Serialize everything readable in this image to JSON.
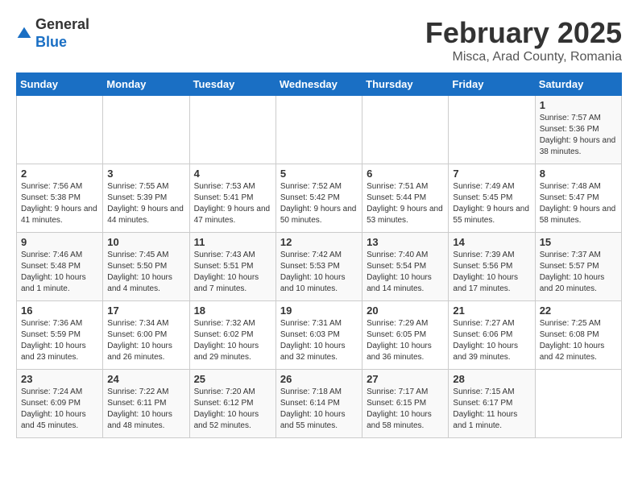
{
  "logo": {
    "general": "General",
    "blue": "Blue"
  },
  "title": "February 2025",
  "subtitle": "Misca, Arad County, Romania",
  "days_of_week": [
    "Sunday",
    "Monday",
    "Tuesday",
    "Wednesday",
    "Thursday",
    "Friday",
    "Saturday"
  ],
  "weeks": [
    [
      {
        "day": "",
        "info": ""
      },
      {
        "day": "",
        "info": ""
      },
      {
        "day": "",
        "info": ""
      },
      {
        "day": "",
        "info": ""
      },
      {
        "day": "",
        "info": ""
      },
      {
        "day": "",
        "info": ""
      },
      {
        "day": "1",
        "info": "Sunrise: 7:57 AM\nSunset: 5:36 PM\nDaylight: 9 hours and 38 minutes."
      }
    ],
    [
      {
        "day": "2",
        "info": "Sunrise: 7:56 AM\nSunset: 5:38 PM\nDaylight: 9 hours and 41 minutes."
      },
      {
        "day": "3",
        "info": "Sunrise: 7:55 AM\nSunset: 5:39 PM\nDaylight: 9 hours and 44 minutes."
      },
      {
        "day": "4",
        "info": "Sunrise: 7:53 AM\nSunset: 5:41 PM\nDaylight: 9 hours and 47 minutes."
      },
      {
        "day": "5",
        "info": "Sunrise: 7:52 AM\nSunset: 5:42 PM\nDaylight: 9 hours and 50 minutes."
      },
      {
        "day": "6",
        "info": "Sunrise: 7:51 AM\nSunset: 5:44 PM\nDaylight: 9 hours and 53 minutes."
      },
      {
        "day": "7",
        "info": "Sunrise: 7:49 AM\nSunset: 5:45 PM\nDaylight: 9 hours and 55 minutes."
      },
      {
        "day": "8",
        "info": "Sunrise: 7:48 AM\nSunset: 5:47 PM\nDaylight: 9 hours and 58 minutes."
      }
    ],
    [
      {
        "day": "9",
        "info": "Sunrise: 7:46 AM\nSunset: 5:48 PM\nDaylight: 10 hours and 1 minute."
      },
      {
        "day": "10",
        "info": "Sunrise: 7:45 AM\nSunset: 5:50 PM\nDaylight: 10 hours and 4 minutes."
      },
      {
        "day": "11",
        "info": "Sunrise: 7:43 AM\nSunset: 5:51 PM\nDaylight: 10 hours and 7 minutes."
      },
      {
        "day": "12",
        "info": "Sunrise: 7:42 AM\nSunset: 5:53 PM\nDaylight: 10 hours and 10 minutes."
      },
      {
        "day": "13",
        "info": "Sunrise: 7:40 AM\nSunset: 5:54 PM\nDaylight: 10 hours and 14 minutes."
      },
      {
        "day": "14",
        "info": "Sunrise: 7:39 AM\nSunset: 5:56 PM\nDaylight: 10 hours and 17 minutes."
      },
      {
        "day": "15",
        "info": "Sunrise: 7:37 AM\nSunset: 5:57 PM\nDaylight: 10 hours and 20 minutes."
      }
    ],
    [
      {
        "day": "16",
        "info": "Sunrise: 7:36 AM\nSunset: 5:59 PM\nDaylight: 10 hours and 23 minutes."
      },
      {
        "day": "17",
        "info": "Sunrise: 7:34 AM\nSunset: 6:00 PM\nDaylight: 10 hours and 26 minutes."
      },
      {
        "day": "18",
        "info": "Sunrise: 7:32 AM\nSunset: 6:02 PM\nDaylight: 10 hours and 29 minutes."
      },
      {
        "day": "19",
        "info": "Sunrise: 7:31 AM\nSunset: 6:03 PM\nDaylight: 10 hours and 32 minutes."
      },
      {
        "day": "20",
        "info": "Sunrise: 7:29 AM\nSunset: 6:05 PM\nDaylight: 10 hours and 36 minutes."
      },
      {
        "day": "21",
        "info": "Sunrise: 7:27 AM\nSunset: 6:06 PM\nDaylight: 10 hours and 39 minutes."
      },
      {
        "day": "22",
        "info": "Sunrise: 7:25 AM\nSunset: 6:08 PM\nDaylight: 10 hours and 42 minutes."
      }
    ],
    [
      {
        "day": "23",
        "info": "Sunrise: 7:24 AM\nSunset: 6:09 PM\nDaylight: 10 hours and 45 minutes."
      },
      {
        "day": "24",
        "info": "Sunrise: 7:22 AM\nSunset: 6:11 PM\nDaylight: 10 hours and 48 minutes."
      },
      {
        "day": "25",
        "info": "Sunrise: 7:20 AM\nSunset: 6:12 PM\nDaylight: 10 hours and 52 minutes."
      },
      {
        "day": "26",
        "info": "Sunrise: 7:18 AM\nSunset: 6:14 PM\nDaylight: 10 hours and 55 minutes."
      },
      {
        "day": "27",
        "info": "Sunrise: 7:17 AM\nSunset: 6:15 PM\nDaylight: 10 hours and 58 minutes."
      },
      {
        "day": "28",
        "info": "Sunrise: 7:15 AM\nSunset: 6:17 PM\nDaylight: 11 hours and 1 minute."
      },
      {
        "day": "",
        "info": ""
      }
    ]
  ]
}
